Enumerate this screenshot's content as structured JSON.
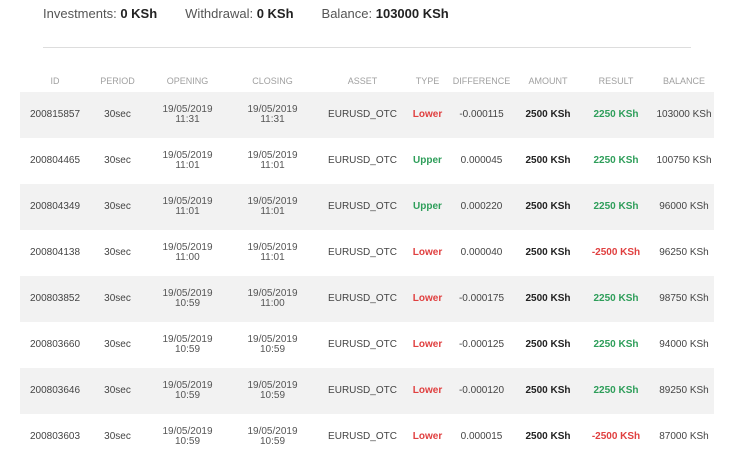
{
  "summary": {
    "investments_label": "Investments: ",
    "investments_value": "0 KSh",
    "withdrawal_label": "Withdrawal: ",
    "withdrawal_value": "0 KSh",
    "balance_label": "Balance: ",
    "balance_value": "103000 KSh"
  },
  "table": {
    "headers": [
      "ID",
      "PERIOD",
      "OPENING",
      "CLOSING",
      "ASSET",
      "TYPE",
      "DIFFERENCE",
      "AMOUNT",
      "RESULT",
      "BALANCE"
    ],
    "rows": [
      {
        "id": "200815857",
        "period": "30sec",
        "opening_date": "19/05/2019",
        "opening_time": "11:31",
        "closing_date": "19/05/2019",
        "closing_time": "11:31",
        "asset": "EURUSD_OTC",
        "type": "Lower",
        "difference": "-0.000115",
        "amount": "2500 KSh",
        "result": "2250 KSh",
        "balance": "103000 KSh"
      },
      {
        "id": "200804465",
        "period": "30sec",
        "opening_date": "19/05/2019",
        "opening_time": "11:01",
        "closing_date": "19/05/2019",
        "closing_time": "11:01",
        "asset": "EURUSD_OTC",
        "type": "Upper",
        "difference": "0.000045",
        "amount": "2500 KSh",
        "result": "2250 KSh",
        "balance": "100750 KSh"
      },
      {
        "id": "200804349",
        "period": "30sec",
        "opening_date": "19/05/2019",
        "opening_time": "11:01",
        "closing_date": "19/05/2019",
        "closing_time": "11:01",
        "asset": "EURUSD_OTC",
        "type": "Upper",
        "difference": "0.000220",
        "amount": "2500 KSh",
        "result": "2250 KSh",
        "balance": "96000 KSh"
      },
      {
        "id": "200804138",
        "period": "30sec",
        "opening_date": "19/05/2019",
        "opening_time": "11:00",
        "closing_date": "19/05/2019",
        "closing_time": "11:01",
        "asset": "EURUSD_OTC",
        "type": "Lower",
        "difference": "0.000040",
        "amount": "2500 KSh",
        "result": "-2500 KSh",
        "balance": "96250 KSh"
      },
      {
        "id": "200803852",
        "period": "30sec",
        "opening_date": "19/05/2019",
        "opening_time": "10:59",
        "closing_date": "19/05/2019",
        "closing_time": "11:00",
        "asset": "EURUSD_OTC",
        "type": "Lower",
        "difference": "-0.000175",
        "amount": "2500 KSh",
        "result": "2250 KSh",
        "balance": "98750 KSh"
      },
      {
        "id": "200803660",
        "period": "30sec",
        "opening_date": "19/05/2019",
        "opening_time": "10:59",
        "closing_date": "19/05/2019",
        "closing_time": "10:59",
        "asset": "EURUSD_OTC",
        "type": "Lower",
        "difference": "-0.000125",
        "amount": "2500 KSh",
        "result": "2250 KSh",
        "balance": "94000 KSh"
      },
      {
        "id": "200803646",
        "period": "30sec",
        "opening_date": "19/05/2019",
        "opening_time": "10:59",
        "closing_date": "19/05/2019",
        "closing_time": "10:59",
        "asset": "EURUSD_OTC",
        "type": "Lower",
        "difference": "-0.000120",
        "amount": "2500 KSh",
        "result": "2250 KSh",
        "balance": "89250 KSh"
      },
      {
        "id": "200803603",
        "period": "30sec",
        "opening_date": "19/05/2019",
        "opening_time": "10:59",
        "closing_date": "19/05/2019",
        "closing_time": "10:59",
        "asset": "EURUSD_OTC",
        "type": "Lower",
        "difference": "0.000015",
        "amount": "2500 KSh",
        "result": "-2500 KSh",
        "balance": "87000 KSh"
      }
    ]
  },
  "colors": {
    "upper": "#2e9e5a",
    "lower": "#e04040",
    "positive": "#2e9e5a",
    "negative": "#e04040"
  }
}
